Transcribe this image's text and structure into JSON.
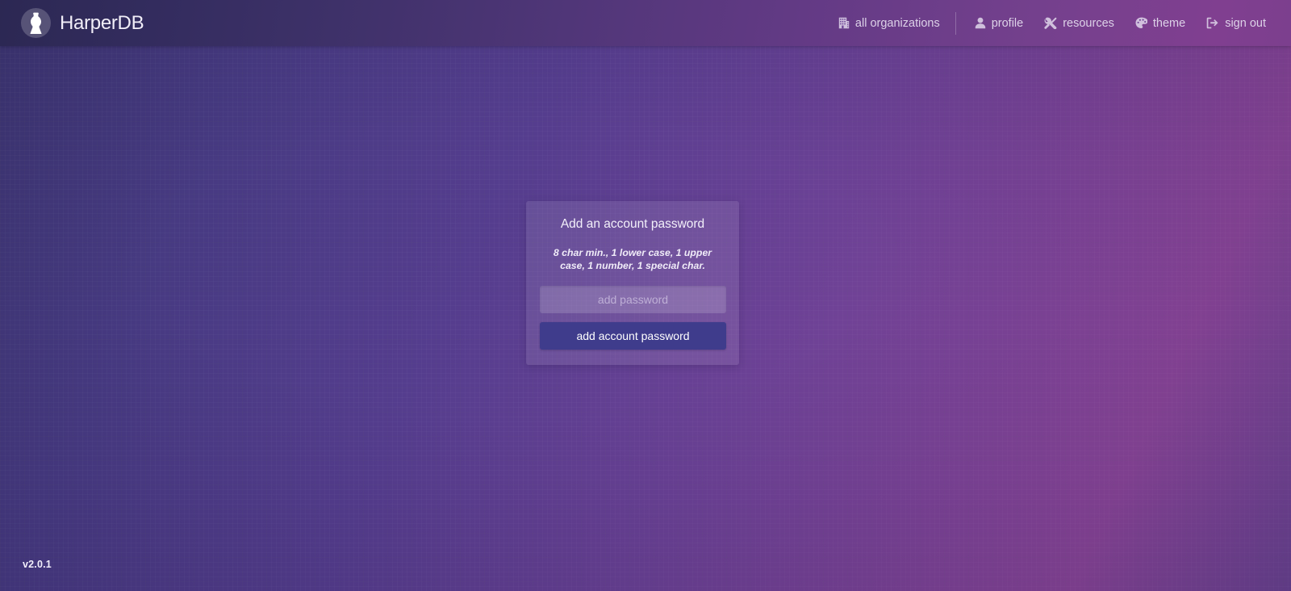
{
  "header": {
    "brand": {
      "name": "HarperDB",
      "logo_icon": "harperdb-pawn-logo"
    },
    "nav": [
      {
        "label": "all organizations",
        "icon": "building-icon"
      },
      {
        "label": "profile",
        "icon": "user-icon"
      },
      {
        "label": "resources",
        "icon": "tools-icon"
      },
      {
        "label": "theme",
        "icon": "palette-icon"
      },
      {
        "label": "sign out",
        "icon": "sign-out-icon"
      }
    ]
  },
  "card": {
    "title": "Add an account password",
    "subtitle": "8 char min., 1 lower case, 1 upper case, 1 number, 1 special char.",
    "password_placeholder": "add password",
    "password_value": "",
    "submit_label": "add account password"
  },
  "footer": {
    "version": "v2.0.1"
  },
  "colors": {
    "header_left": "#2c2853",
    "header_right": "#7c3f8e",
    "page_bg_left": "#3b3470",
    "page_bg_right": "#8a4599",
    "card_bg": "rgba(255,255,255,0.095)",
    "button_bg": "#3f3c8c",
    "text_light": "#f1eef8",
    "nav_text": "#ddd2e8"
  }
}
